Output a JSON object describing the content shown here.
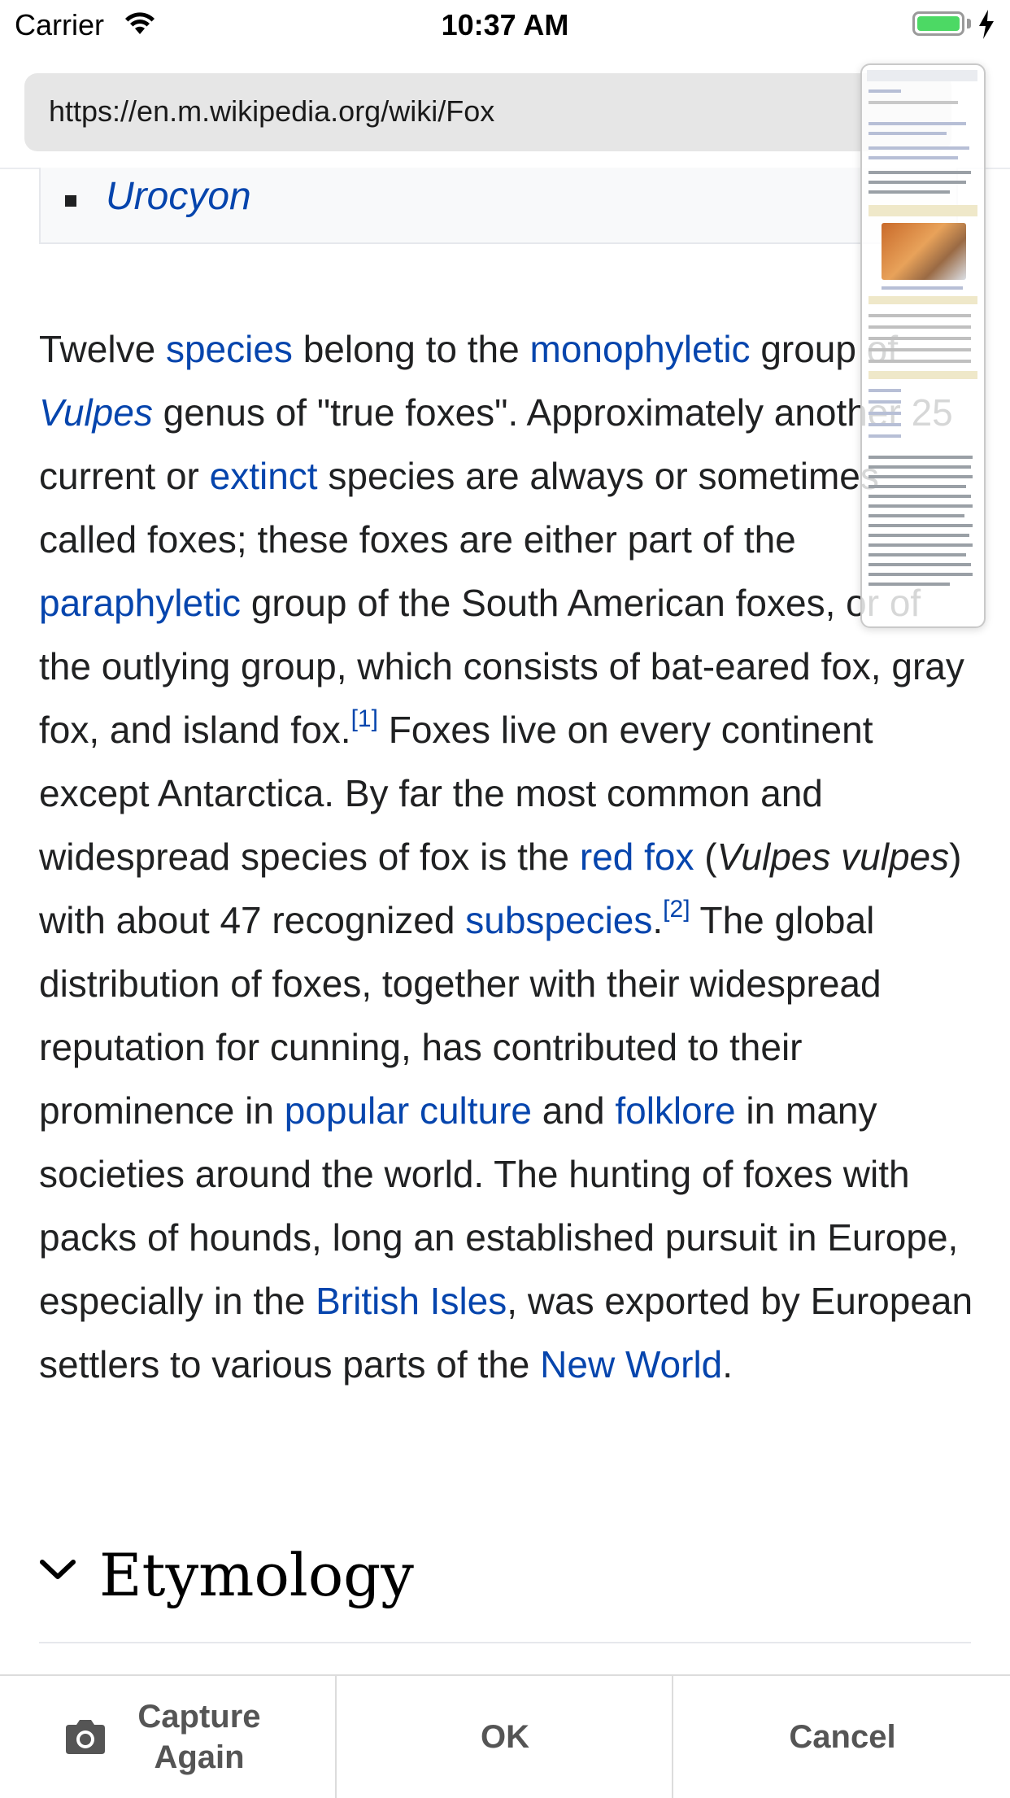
{
  "status_bar": {
    "carrier": "Carrier",
    "time": "10:37 AM",
    "icons": [
      "wifi-icon",
      "battery-icon",
      "charging-bolt-icon"
    ],
    "battery_level": 1.0
  },
  "browser": {
    "url": "https://en.m.wikipedia.org/wiki/Fox"
  },
  "article": {
    "list_item": "Urocyon",
    "paragraph": {
      "s1_a": "Twelve ",
      "l_species": "species",
      "s1_b": " belong to the ",
      "l_monophyletic": "monophyletic",
      "s1_c": " group of ",
      "l_vulpes": "Vulpes",
      "s1_d": " genus of \"true foxes\". Approximately another 25 current or ",
      "l_extinct": "extinct",
      "s1_e": " species are always or sometimes called foxes; these foxes are either part of the ",
      "l_paraphyletic": "paraphyletic",
      "s1_f": " group of the South American foxes, or of the outlying group, which consists of bat-eared fox, gray fox, and island fox.",
      "ref1": "[1]",
      "s2_a": " Foxes live on every continent except Antarctica. By far the most common and widespread species of fox is the ",
      "l_redfox": "red fox",
      "s2_b": " (",
      "i_vulpes_vulpes": "Vulpes vulpes",
      "s2_c": ") with about 47 recognized ",
      "l_subspecies": "subspecies",
      "s2_d": ".",
      "ref2": "[2]",
      "s3_a": " The global distribution of foxes, together with their widespread reputation for cunning, has contributed to their prominence in ",
      "l_popular_culture": "popular culture",
      "s3_b": " and ",
      "l_folklore": "folklore",
      "s3_c": " in many societies around the world. The hunting of foxes with packs of hounds, long an established pursuit in Europe, especially in the ",
      "l_british_isles": "British Isles",
      "s3_d": ", was exported by European settlers to various parts of the ",
      "l_new_world": "New World",
      "s3_e": "."
    },
    "section_heading": "Etymology",
    "link_color": "#0645ad"
  },
  "toolbar": {
    "capture_label": "Capture Again",
    "ok_label": "OK",
    "cancel_label": "Cancel"
  }
}
